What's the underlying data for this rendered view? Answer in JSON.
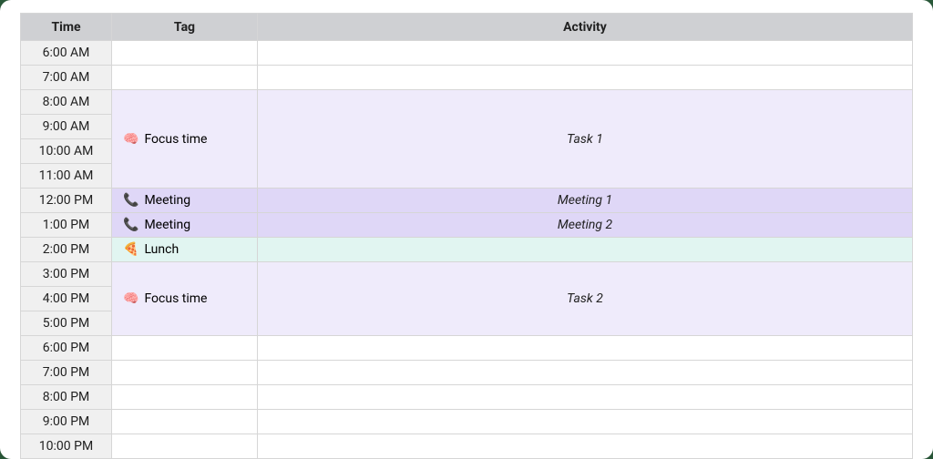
{
  "headers": {
    "time": "Time",
    "tag": "Tag",
    "activity": "Activity"
  },
  "icons": {
    "brain": "🧠",
    "phone": "📞",
    "pizza": "🍕"
  },
  "times": [
    "6:00 AM",
    "7:00 AM",
    "8:00 AM",
    "9:00 AM",
    "10:00 AM",
    "11:00 AM",
    "12:00 PM",
    "1:00 PM",
    "2:00 PM",
    "3:00 PM",
    "4:00 PM",
    "5:00 PM",
    "6:00 PM",
    "7:00 PM",
    "8:00 PM",
    "9:00 PM",
    "10:00 PM"
  ],
  "blocks": {
    "focus1": {
      "tag": "Focus time",
      "activity": "Task 1"
    },
    "meeting1": {
      "tag": "Meeting",
      "activity": "Meeting 1"
    },
    "meeting2": {
      "tag": "Meeting",
      "activity": "Meeting 2"
    },
    "lunch": {
      "tag": "Lunch",
      "activity": ""
    },
    "focus2": {
      "tag": "Focus time",
      "activity": "Task 2"
    }
  },
  "colors": {
    "header_bg": "#cfd0d3",
    "time_bg": "#f0f0f0",
    "focus_bg": "#efebfb",
    "meeting_bg": "#dfd7f7",
    "lunch_bg": "#e1f5f1",
    "border": "#d6d6d6"
  }
}
